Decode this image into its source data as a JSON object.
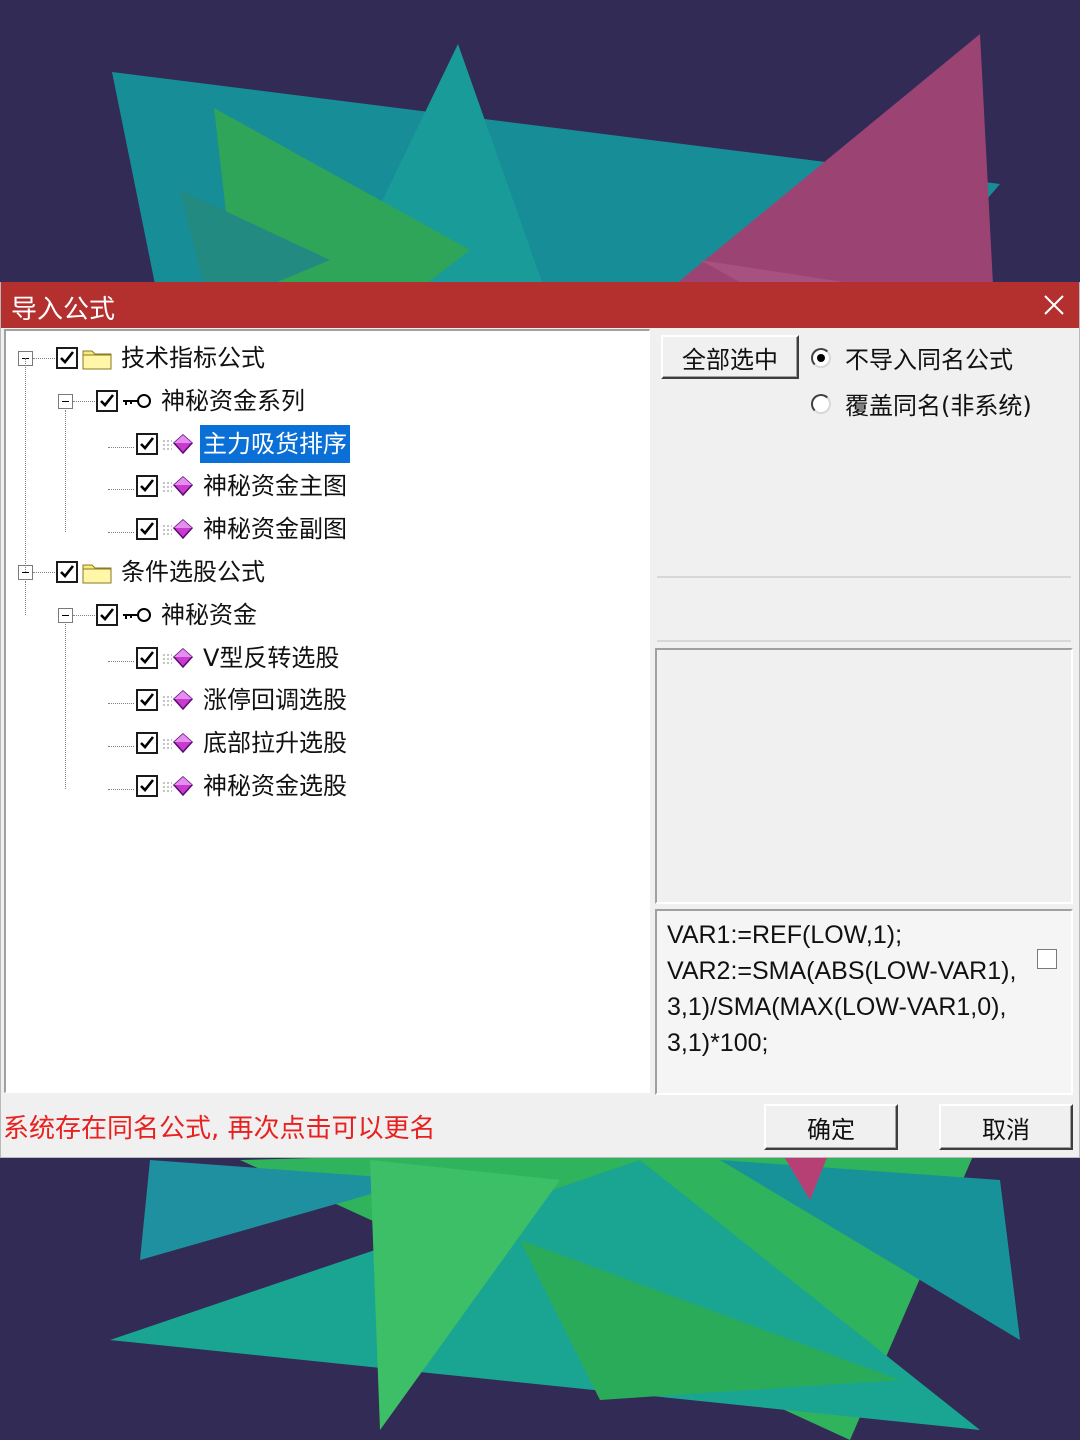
{
  "dialog": {
    "title": "导入公式",
    "close_icon": "close-icon",
    "title_color": "#b3302f"
  },
  "tree": [
    {
      "label": "技术指标公式",
      "icon": "folder-icon",
      "checked": true,
      "level": 0,
      "expanded": true
    },
    {
      "label": "神秘资金系列",
      "icon": "key-icon",
      "checked": true,
      "level": 1,
      "expanded": true
    },
    {
      "label": "主力吸货排序",
      "icon": "gem-icon",
      "checked": true,
      "level": 2,
      "selected": true
    },
    {
      "label": "神秘资金主图",
      "icon": "gem-icon",
      "checked": true,
      "level": 2
    },
    {
      "label": "神秘资金副图",
      "icon": "gem-icon",
      "checked": true,
      "level": 2
    },
    {
      "label": "条件选股公式",
      "icon": "folder-icon",
      "checked": true,
      "level": 0,
      "expanded": true
    },
    {
      "label": "神秘资金",
      "icon": "key-icon",
      "checked": true,
      "level": 1,
      "expanded": true
    },
    {
      "label": "V型反转选股",
      "icon": "gem-icon",
      "checked": true,
      "level": 2
    },
    {
      "label": "涨停回调选股",
      "icon": "gem-icon",
      "checked": true,
      "level": 2
    },
    {
      "label": "底部拉升选股",
      "icon": "gem-icon",
      "checked": true,
      "level": 2
    },
    {
      "label": "神秘资金选股",
      "icon": "gem-icon",
      "checked": true,
      "level": 2
    }
  ],
  "options": {
    "select_all_label": "全部选中",
    "radio_skip_label": "不导入同名公式",
    "radio_overwrite_label": "覆盖同名(非系统)",
    "selected_radio": "skip"
  },
  "code_preview": {
    "text": "VAR1:=REF(LOW,1);\nVAR2:=SMA(ABS(LOW-VAR1),3,1)/SMA(MAX(LOW-VAR1,0),3,1)*100;"
  },
  "status": {
    "message": "系统存在同名公式, 再次点击可以更名",
    "color": "#e8201f"
  },
  "buttons": {
    "ok_label": "确定",
    "cancel_label": "取消"
  }
}
